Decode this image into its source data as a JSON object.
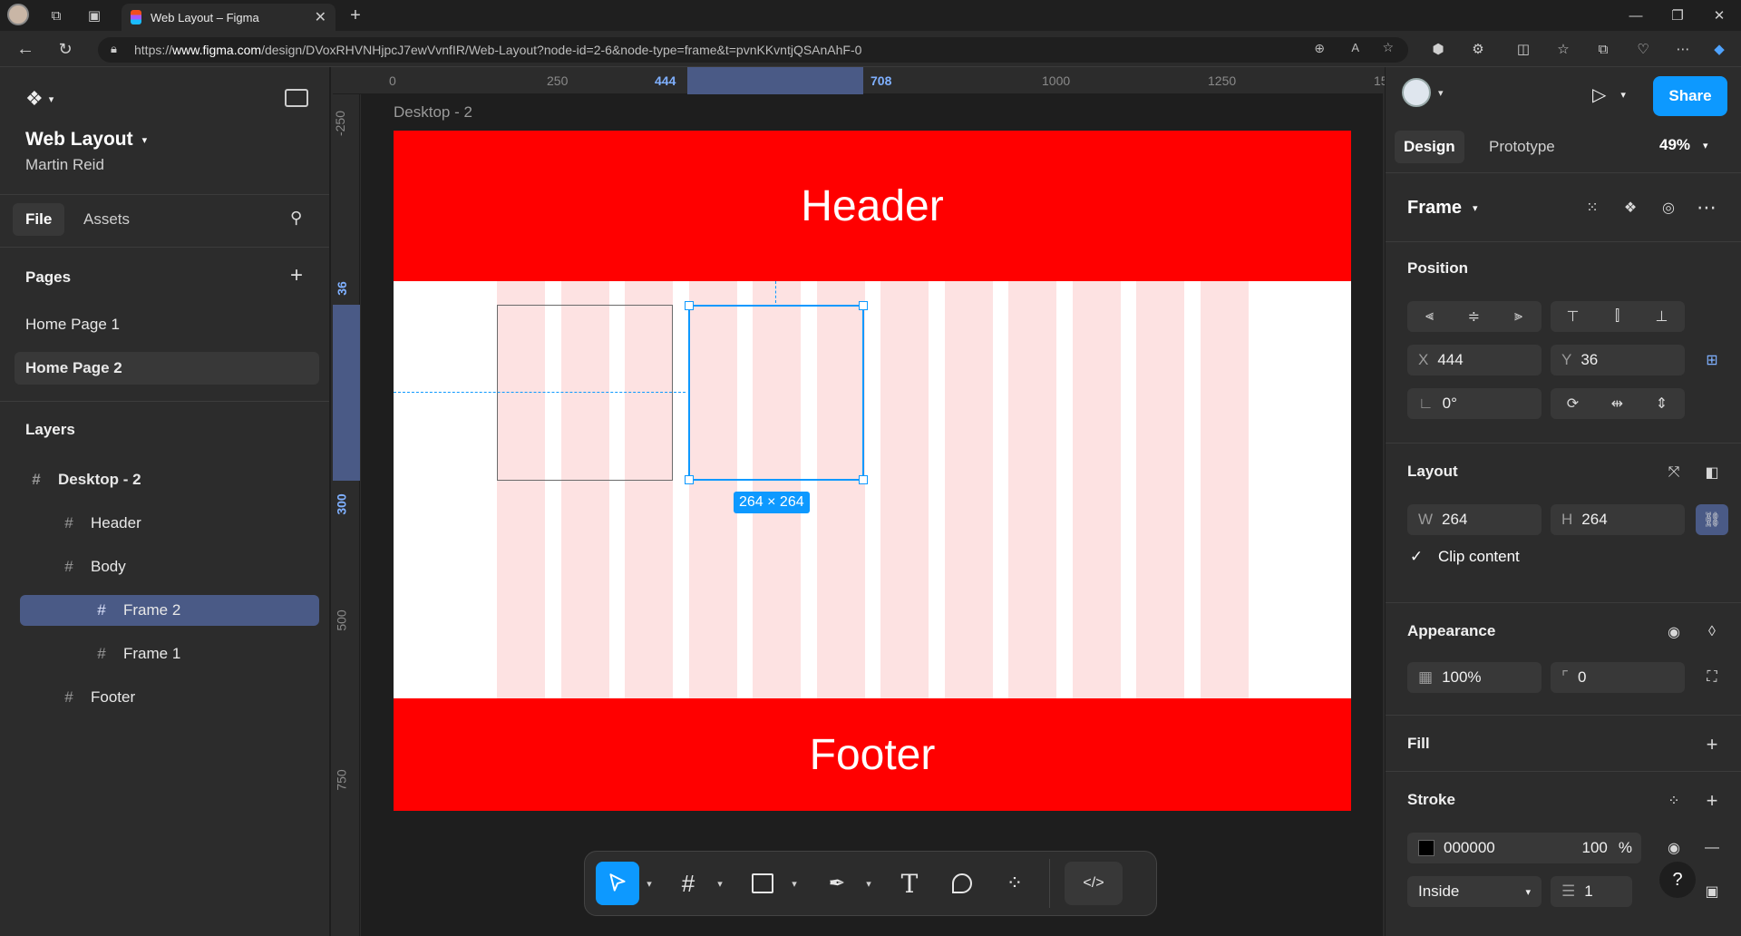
{
  "browser": {
    "tab_title": "Web Layout – Figma",
    "url_prefix": "https://",
    "url_host": "www.figma.com",
    "url_path": "/design/DVoxRHVNHjpcJ7ewVvnfIR/Web-Layout?node-id=2-6&node-type=frame&t=pvnKKvntjQSAnAhF-0"
  },
  "file": {
    "name": "Web Layout",
    "owner": "Martin Reid"
  },
  "left_tabs": {
    "file": "File",
    "assets": "Assets"
  },
  "pages": {
    "label": "Pages",
    "items": [
      "Home Page 1",
      "Home Page 2"
    ],
    "selected": "Home Page 2"
  },
  "layers": {
    "label": "Layers",
    "items": [
      {
        "name": "Desktop - 2",
        "level": 0
      },
      {
        "name": "Header",
        "level": 1
      },
      {
        "name": "Body",
        "level": 1
      },
      {
        "name": "Frame 2",
        "level": 2,
        "selected": true
      },
      {
        "name": "Frame 1",
        "level": 2
      },
      {
        "name": "Footer",
        "level": 1
      }
    ]
  },
  "rulers": {
    "h_ticks": [
      "0",
      "250",
      "444",
      "708",
      "1000",
      "1250",
      "15"
    ],
    "v_ticks": [
      "-250",
      "36",
      "300",
      "500",
      "750"
    ]
  },
  "canvas": {
    "frame_label": "Desktop - 2",
    "header_text": "Header",
    "footer_text": "Footer",
    "size_badge": "264 × 264",
    "header_color": "#ff0000",
    "footer_color": "#ff0000",
    "column_color": "#fde2e2",
    "selection_color": "#0d99ff"
  },
  "right": {
    "share": "Share",
    "tab_design": "Design",
    "tab_prototype": "Prototype",
    "zoom": "49%",
    "frame_label": "Frame",
    "position_label": "Position",
    "x_label": "X",
    "x_value": "444",
    "y_label": "Y",
    "y_value": "36",
    "rotation": "0°",
    "layout_label": "Layout",
    "w_label": "W",
    "w_value": "264",
    "h_label": "H",
    "h_value": "264",
    "clip_content": "Clip content",
    "appearance_label": "Appearance",
    "opacity": "100%",
    "radius": "0",
    "fill_label": "Fill",
    "stroke_label": "Stroke",
    "stroke_color": "000000",
    "stroke_opacity": "100",
    "stroke_pct": "%",
    "stroke_position": "Inside",
    "stroke_weight": "1"
  }
}
